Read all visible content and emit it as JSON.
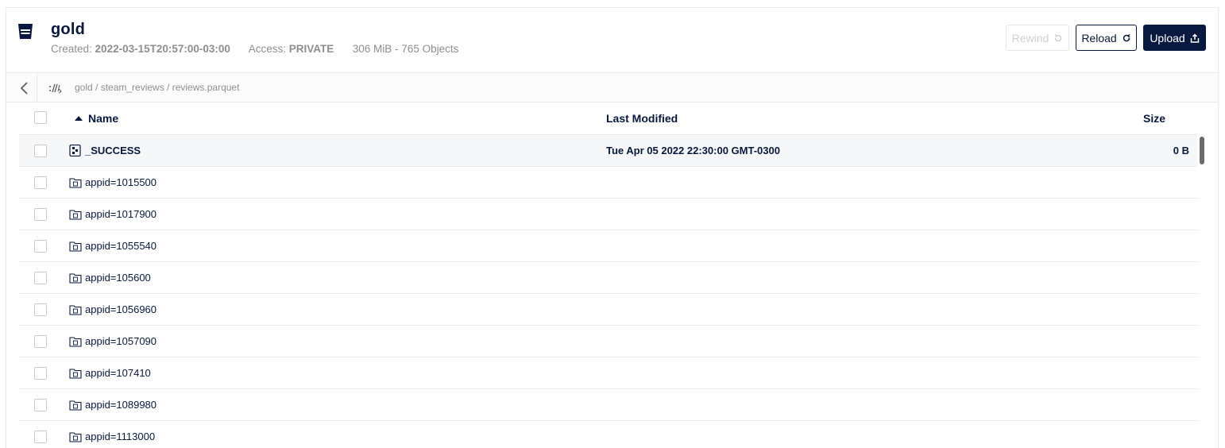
{
  "bucket": {
    "name": "gold",
    "created_label": "Created:",
    "created_value": "2022-03-15T20:57:00-03:00",
    "access_label": "Access:",
    "access_value": "PRIVATE",
    "usage": "306 MiB - 765 Objects"
  },
  "actions": {
    "rewind_label": "Rewind",
    "reload_label": "Reload",
    "upload_label": "Upload"
  },
  "breadcrumb": {
    "path": "gold / steam_reviews / reviews.parquet"
  },
  "table": {
    "headers": {
      "name": "Name",
      "modified": "Last Modified",
      "size": "Size"
    },
    "sort": {
      "column": "Name",
      "direction": "ascending"
    },
    "rows": [
      {
        "name": "_SUCCESS",
        "type": "file",
        "modified": "Tue Apr 05 2022 22:30:00 GMT-0300",
        "size": "0 B"
      },
      {
        "name": "appid=1015500",
        "type": "folder",
        "modified": "",
        "size": ""
      },
      {
        "name": "appid=1017900",
        "type": "folder",
        "modified": "",
        "size": ""
      },
      {
        "name": "appid=1055540",
        "type": "folder",
        "modified": "",
        "size": ""
      },
      {
        "name": "appid=105600",
        "type": "folder",
        "modified": "",
        "size": ""
      },
      {
        "name": "appid=1056960",
        "type": "folder",
        "modified": "",
        "size": ""
      },
      {
        "name": "appid=1057090",
        "type": "folder",
        "modified": "",
        "size": ""
      },
      {
        "name": "appid=107410",
        "type": "folder",
        "modified": "",
        "size": ""
      },
      {
        "name": "appid=1089980",
        "type": "folder",
        "modified": "",
        "size": ""
      },
      {
        "name": "appid=1113000",
        "type": "folder",
        "modified": "",
        "size": ""
      }
    ]
  },
  "colors": {
    "primary": "#07193E",
    "muted": "#8e8e8e",
    "border": "#eaeaea"
  }
}
